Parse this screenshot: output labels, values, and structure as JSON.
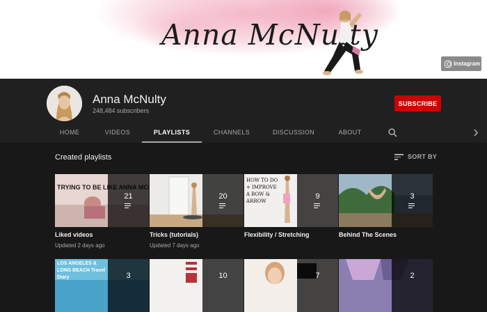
{
  "banner": {
    "title": "Anna McNulty",
    "instagram_label": "Instagram"
  },
  "channel": {
    "name": "Anna McNulty",
    "subscribers": "248,484 subscribers",
    "subscribe_label": "SUBSCRIBE"
  },
  "tabs": [
    {
      "label": "HOME"
    },
    {
      "label": "VIDEOS"
    },
    {
      "label": "PLAYLISTS",
      "active": true
    },
    {
      "label": "CHANNELS"
    },
    {
      "label": "DISCUSSION"
    },
    {
      "label": "ABOUT"
    }
  ],
  "icons": {
    "search": "search-icon",
    "next": "chevron-right-icon",
    "sort": "sort-icon",
    "playlist": "playlist-icon"
  },
  "section": {
    "title": "Created playlists",
    "sort_label": "SORT BY"
  },
  "playlists": [
    {
      "title": "Liked videos",
      "count": "21",
      "meta": "Updated 2 days ago",
      "thumb_text": "TRYING TO BE LIKE ANNA MCNULTY"
    },
    {
      "title": "Tricks (tutorials)",
      "count": "20",
      "meta": "Updated 7 days ago"
    },
    {
      "title": "Flexibility / Stretching",
      "count": "9",
      "meta": "",
      "thumb_text": "HOW TO DO + IMPROVE A BOW & ARROW"
    },
    {
      "title": "Behind The Scenes",
      "count": "3",
      "meta": ""
    }
  ],
  "playlists_row2": [
    {
      "count": "3",
      "thumb_text": "LOS ANGELES & LONG BEACH Travel Diary"
    },
    {
      "count": "10"
    },
    {
      "count": "7"
    },
    {
      "count": "2"
    }
  ],
  "colors": {
    "page_bg": "#181818",
    "header_bg": "#202020",
    "subscribe": "#cc0000",
    "text_primary": "#f1f1f1",
    "text_secondary": "#aaaaaa"
  }
}
